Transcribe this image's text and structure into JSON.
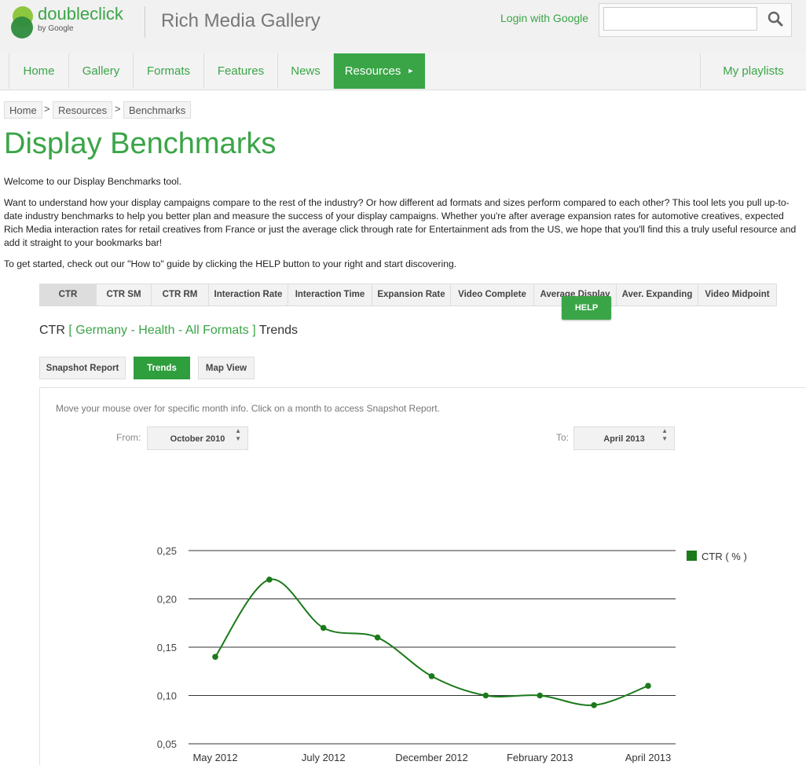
{
  "header": {
    "brand": "doubleclick",
    "brand_sub": "by Google",
    "site_title": "Rich Media Gallery",
    "login": "Login with Google",
    "search_placeholder": ""
  },
  "nav": {
    "items": [
      {
        "label": "Home"
      },
      {
        "label": "Gallery"
      },
      {
        "label": "Formats"
      },
      {
        "label": "Features"
      },
      {
        "label": "News"
      },
      {
        "label": "Resources"
      }
    ],
    "right": "My playlists"
  },
  "breadcrumb": [
    "Home",
    "Resources",
    "Benchmarks"
  ],
  "breadcrumb_sep": ">",
  "page_title": "Display Benchmarks",
  "intro": [
    "Welcome to our Display Benchmarks tool.",
    "Want to understand how your display campaigns compare to the rest of the industry? Or how different ad formats and sizes perform compared to each other? This tool lets you pull up-to-date industry benchmarks to help you better plan and measure the success of your display campaigns. Whether you're after average expansion rates for automotive creatives, expected Rich Media interaction rates for retail creatives from France or just the average click through rate for Entertainment ads from the US, we hope that you'll find this a truly useful resource and add it straight to your bookmarks bar!",
    "To get started, check out our \"How to\" guide by clicking the HELP button to your right and start discovering."
  ],
  "tabs": [
    "CTR",
    "CTR SM",
    "CTR RM",
    "Interaction Rate",
    "Interaction Time",
    "Expansion Rate",
    "Video Complete",
    "Average Display",
    "Aver. Expanding",
    "Video Midpoint"
  ],
  "help": "HELP",
  "subtitle": {
    "metric": "CTR",
    "open": "[",
    "filter": "Germany - Health - All Formats",
    "close": "]",
    "view": "Trends"
  },
  "view_buttons": [
    "Snapshot Report",
    "Trends",
    "Map View"
  ],
  "hint": "Move your mouse over for specific month info. Click on a month to access Snapshot Report.",
  "range": {
    "from_label": "From:",
    "from_value": "October 2010",
    "to_label": "To:",
    "to_value": "April 2013"
  },
  "chart_data": {
    "type": "line",
    "x_tick_labels": [
      "May 2012",
      "July 2012",
      "December 2012",
      "February 2013",
      "April 2013"
    ],
    "y_tick_labels": [
      "0,25",
      "0,20",
      "0,15",
      "0,10",
      "0,05"
    ],
    "y_ticks": [
      0.25,
      0.2,
      0.15,
      0.1,
      0.05
    ],
    "ylim": [
      0.05,
      0.25
    ],
    "grid": true,
    "legend": "right",
    "color": "#1b7a1b",
    "series": [
      {
        "name": "CTR ( % )",
        "values": [
          0.14,
          0.22,
          0.17,
          0.16,
          0.12,
          0.1,
          0.1,
          0.09,
          0.11
        ]
      }
    ]
  }
}
